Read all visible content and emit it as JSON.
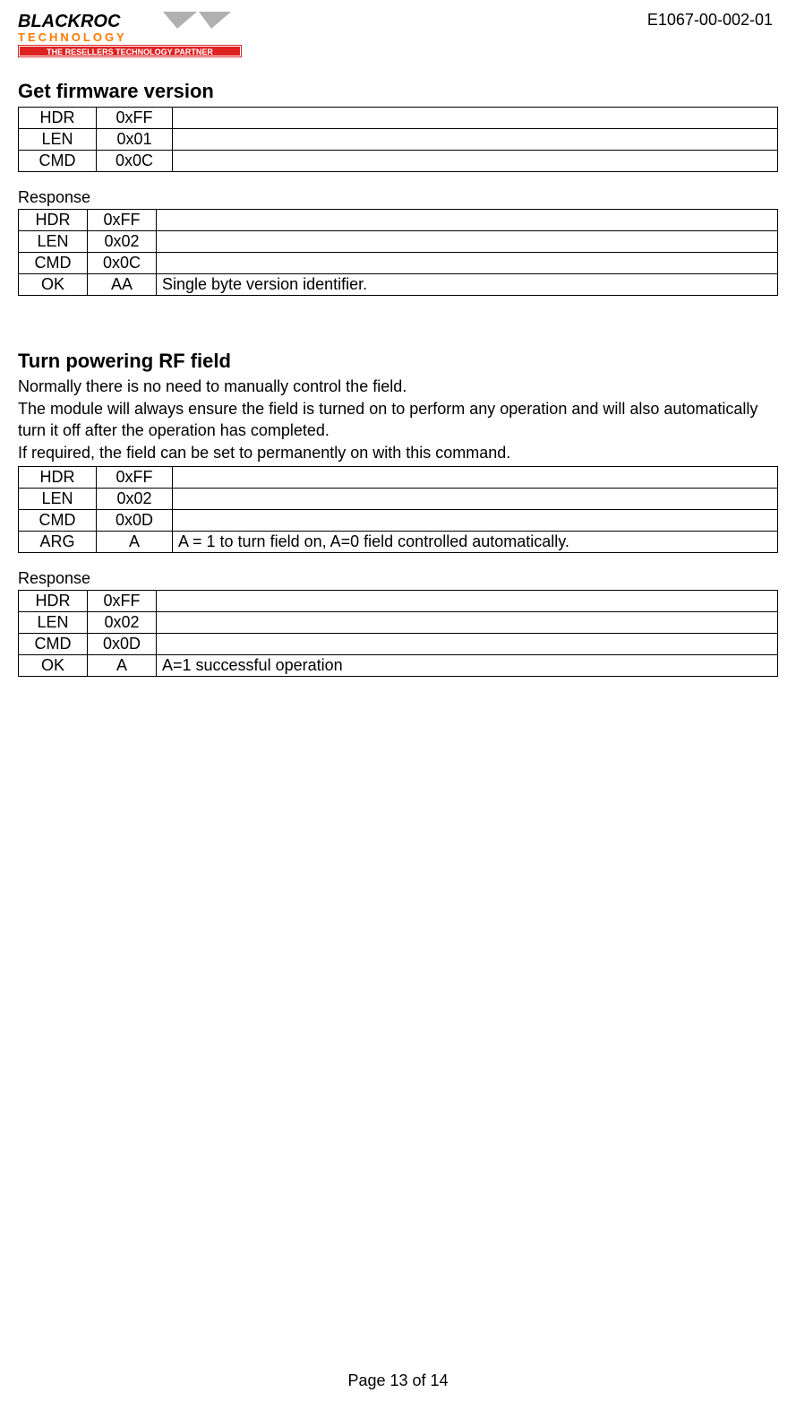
{
  "header": {
    "doc_id": "E1067-00-002-01",
    "logo": {
      "line1": "BLACKROC",
      "line2": "TECHNOLOGY",
      "tagline": "THE RESELLERS TECHNOLOGY PARTNER"
    }
  },
  "section1": {
    "title": "Get firmware version",
    "request": [
      {
        "label": "HDR",
        "value": "0xFF",
        "desc": ""
      },
      {
        "label": "LEN",
        "value": "0x01",
        "desc": ""
      },
      {
        "label": "CMD",
        "value": "0x0C",
        "desc": ""
      }
    ],
    "response_heading": "Response",
    "response": [
      {
        "label": "HDR",
        "value": "0xFF",
        "desc": ""
      },
      {
        "label": "LEN",
        "value": "0x02",
        "desc": ""
      },
      {
        "label": "CMD",
        "value": "0x0C",
        "desc": ""
      },
      {
        "label": "OK",
        "value": "AA",
        "desc": "Single byte version identifier."
      }
    ]
  },
  "section2": {
    "title": "Turn powering RF field",
    "paragraphs": [
      "Normally there is no need to manually control the field.",
      "The module will always ensure the field is turned on to perform any operation and will also automatically turn it off after the operation has completed.",
      "If required, the field can be set to permanently on with this command."
    ],
    "request": [
      {
        "label": "HDR",
        "value": "0xFF",
        "desc": ""
      },
      {
        "label": "LEN",
        "value": "0x02",
        "desc": ""
      },
      {
        "label": "CMD",
        "value": "0x0D",
        "desc": ""
      },
      {
        "label": "ARG",
        "value": "A",
        "desc": "A = 1 to turn field on, A=0 field controlled automatically."
      }
    ],
    "response_heading": "Response",
    "response": [
      {
        "label": "HDR",
        "value": "0xFF",
        "desc": ""
      },
      {
        "label": "LEN",
        "value": "0x02",
        "desc": ""
      },
      {
        "label": "CMD",
        "value": "0x0D",
        "desc": ""
      },
      {
        "label": "OK",
        "value": "A",
        "desc": "A=1 successful operation"
      }
    ]
  },
  "footer": {
    "page": "Page 13 of 14"
  }
}
